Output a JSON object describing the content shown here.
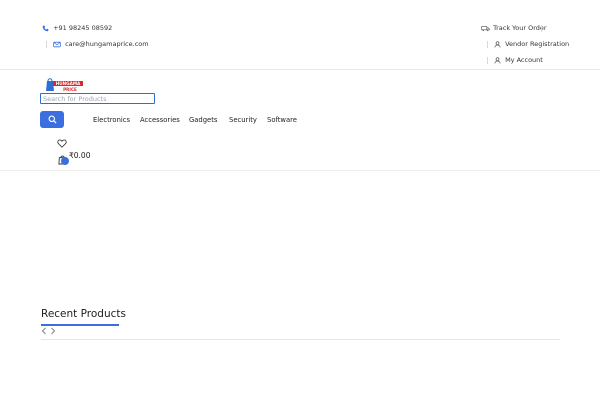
{
  "topbar": {
    "phone": "+91 98245 08592",
    "email": "care@hungamaprice.com",
    "track_order": "Track Your Order",
    "vendor_registration": "Vendor Registration",
    "my_account": "My Account"
  },
  "logo": {
    "text": "HUNGAMA",
    "sub": "PRICE"
  },
  "search": {
    "placeholder": "Search for Products",
    "value": ""
  },
  "nav": {
    "items": [
      {
        "label": "Electronics"
      },
      {
        "label": "Accessories"
      },
      {
        "label": "Gadgets"
      },
      {
        "label": "Security"
      },
      {
        "label": "Software"
      }
    ]
  },
  "cart": {
    "total": "₹0.00"
  },
  "recent": {
    "title": "Recent Products"
  },
  "colors": {
    "accent": "#3b6fe0",
    "logo_red": "#d9282f"
  },
  "icons": {
    "phone": "phone-icon",
    "email": "mail-icon",
    "track": "truck-icon",
    "user": "user-icon",
    "search": "search-icon",
    "wishlist": "heart-icon",
    "cart": "bag-icon",
    "prev": "chevron-left-icon",
    "next": "chevron-right-icon"
  }
}
